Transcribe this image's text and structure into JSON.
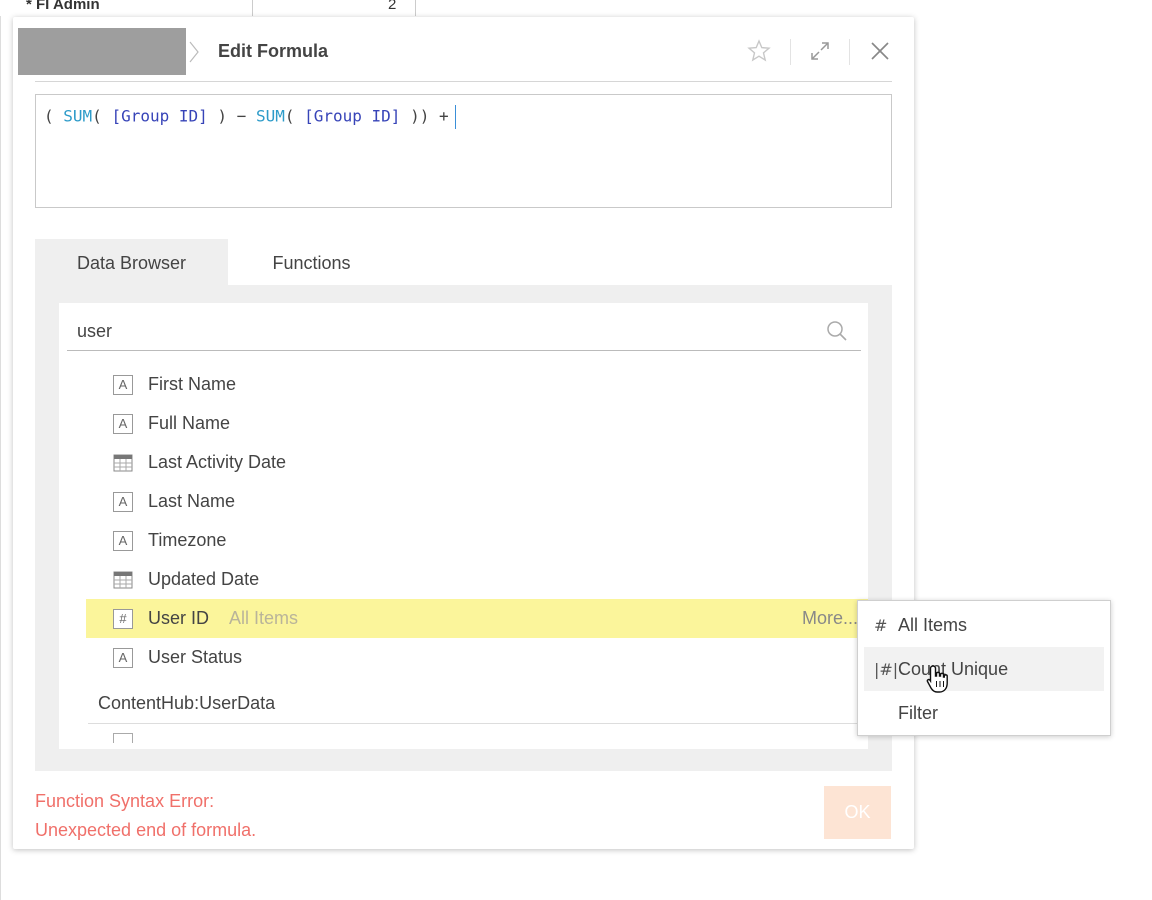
{
  "background": {
    "row_label": "* FI Admin",
    "row_value": "2"
  },
  "dialog": {
    "title": "Edit Formula",
    "icons": {
      "favorite": "star-icon",
      "expand": "expand-icon",
      "close": "close-icon"
    }
  },
  "formula": {
    "tokens": [
      {
        "t": "( ",
        "k": "plain"
      },
      {
        "t": "SUM",
        "k": "fn"
      },
      {
        "t": "( ",
        "k": "plain"
      },
      {
        "t": "[Group ID]",
        "k": "field"
      },
      {
        "t": " ) − ",
        "k": "plain"
      },
      {
        "t": "SUM",
        "k": "fn"
      },
      {
        "t": "( ",
        "k": "plain"
      },
      {
        "t": "[Group ID]",
        "k": "field"
      },
      {
        "t": " )) +",
        "k": "plain"
      }
    ]
  },
  "tabs": [
    {
      "label": "Data Browser",
      "active": true
    },
    {
      "label": "Functions",
      "active": false
    }
  ],
  "search": {
    "value": "user",
    "placeholder": ""
  },
  "fields": [
    {
      "label": "First Name",
      "type": "text"
    },
    {
      "label": "Full Name",
      "type": "text"
    },
    {
      "label": "Last Activity Date",
      "type": "date"
    },
    {
      "label": "Last Name",
      "type": "text"
    },
    {
      "label": "Timezone",
      "type": "text"
    },
    {
      "label": "Updated Date",
      "type": "date"
    },
    {
      "label": "User ID",
      "type": "number",
      "sub": "All Items",
      "more": "More...",
      "highlight": true
    },
    {
      "label": "User Status",
      "type": "text"
    }
  ],
  "group_label": "ContentHub:UserData",
  "error": {
    "line1": "Function Syntax Error:",
    "line2": "Unexpected end of formula."
  },
  "ok_label": "OK",
  "context_menu": [
    {
      "glyph": "#",
      "label": "All Items"
    },
    {
      "glyph": "|#|",
      "label": "Count Unique",
      "hover": true
    },
    {
      "glyph": "",
      "label": "Filter"
    }
  ],
  "colors": {
    "highlight": "#fbf59b",
    "error": "#f0706a",
    "function_token": "#2d9bc9",
    "field_token": "#3744b8"
  }
}
